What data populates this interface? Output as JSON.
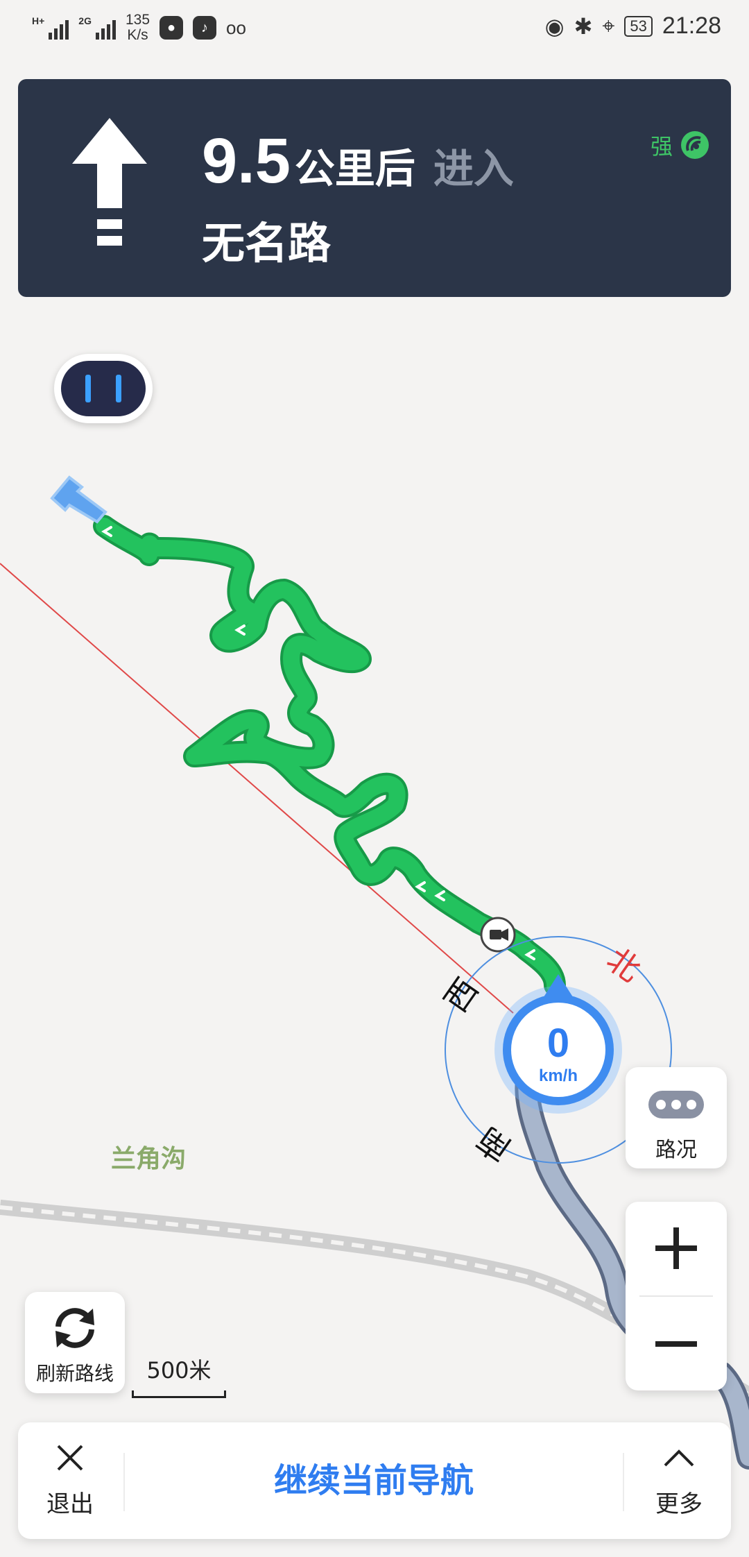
{
  "status_bar": {
    "signal_1_label": "H+",
    "signal_2_label": "2G",
    "net_speed": "135",
    "net_speed_unit": "K/s",
    "app_icons": [
      "du-icon",
      "tiktok-icon",
      "voicemail-icon"
    ],
    "battery": "53",
    "time": "21:28",
    "right_icons": [
      "eye-icon",
      "bluetooth-icon",
      "location-icon"
    ]
  },
  "guidance": {
    "distance": "9.5",
    "distance_unit": "公里后",
    "action": "进入",
    "road": "无名路",
    "gps_strength": "强",
    "direction_icon": "straight-arrow-icon"
  },
  "map": {
    "compass": {
      "north": "北",
      "west": "西",
      "south": "南"
    },
    "speed": "0",
    "speed_unit": "km/h",
    "place_label": "兰角沟",
    "colors": {
      "route": "#1fc05b",
      "traveled": "#8b9ab3",
      "compass_ring": "#4e8fe0",
      "north": "#e03b3b"
    }
  },
  "controls": {
    "traffic_label": "路况",
    "refresh_label": "刷新路线",
    "scale_label": "500米",
    "exit_label": "退出",
    "continue_label": "继续当前导航",
    "more_label": "更多"
  }
}
